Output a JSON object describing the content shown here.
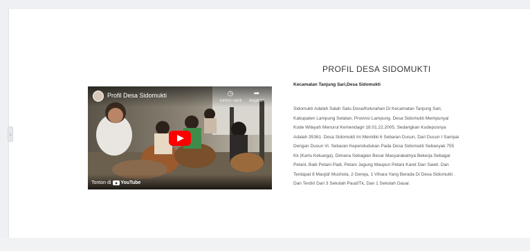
{
  "video": {
    "title": "Profil Desa Sidomukti",
    "watch_later_label": "Tonton nanti",
    "share_label": "Bagikan",
    "watch_on_label": "Tonton di",
    "platform_name": "YouTube",
    "play_color": "#ff0000"
  },
  "profile": {
    "heading": "PROFIL DESA SIDOMUKTI",
    "subheading": "Kecamatan Tanjung Sari,Desa Sidomukti",
    "body": "Sidomukti Adalah Salah Satu Desa/Kelurahan Di Kecamatan Tanjung Sari, Kabupaten Lampung Selatan, Provinsi Lampung. Desa Sidomukti Mempunyai Kode Wilayah Menurut Kemendagri 18.01.22.2005, Sedangkan Kodeposnya Adalah 35361. Desa Sidomukti Ini Memiliki 6 Sebaran Dusun, Dari Dusun I Sampai Dengan Dusun Vi. Sebaran Kependudukan Pada Desa Sidomukti Sebanyak 755 Kk (Kartu Keluarga). Dimana Sebagian Besar Masyarakatnya Bekerja Sebagai Petani, Baik Petani Padi, Petani Jagung Maupun Petani Karet Dan Sawit. Dan Terdapat 8 Masjid/ Mushola, 2 Gereja, 1 Vihara Yang Berada Di Desa Sidomukti . Dan Terdiri Dari 3 Sekolah Paud/Tk, Dan 1 Sekolah Dasar."
  },
  "slider": {
    "handle_icon": "chevron-right-icon"
  }
}
